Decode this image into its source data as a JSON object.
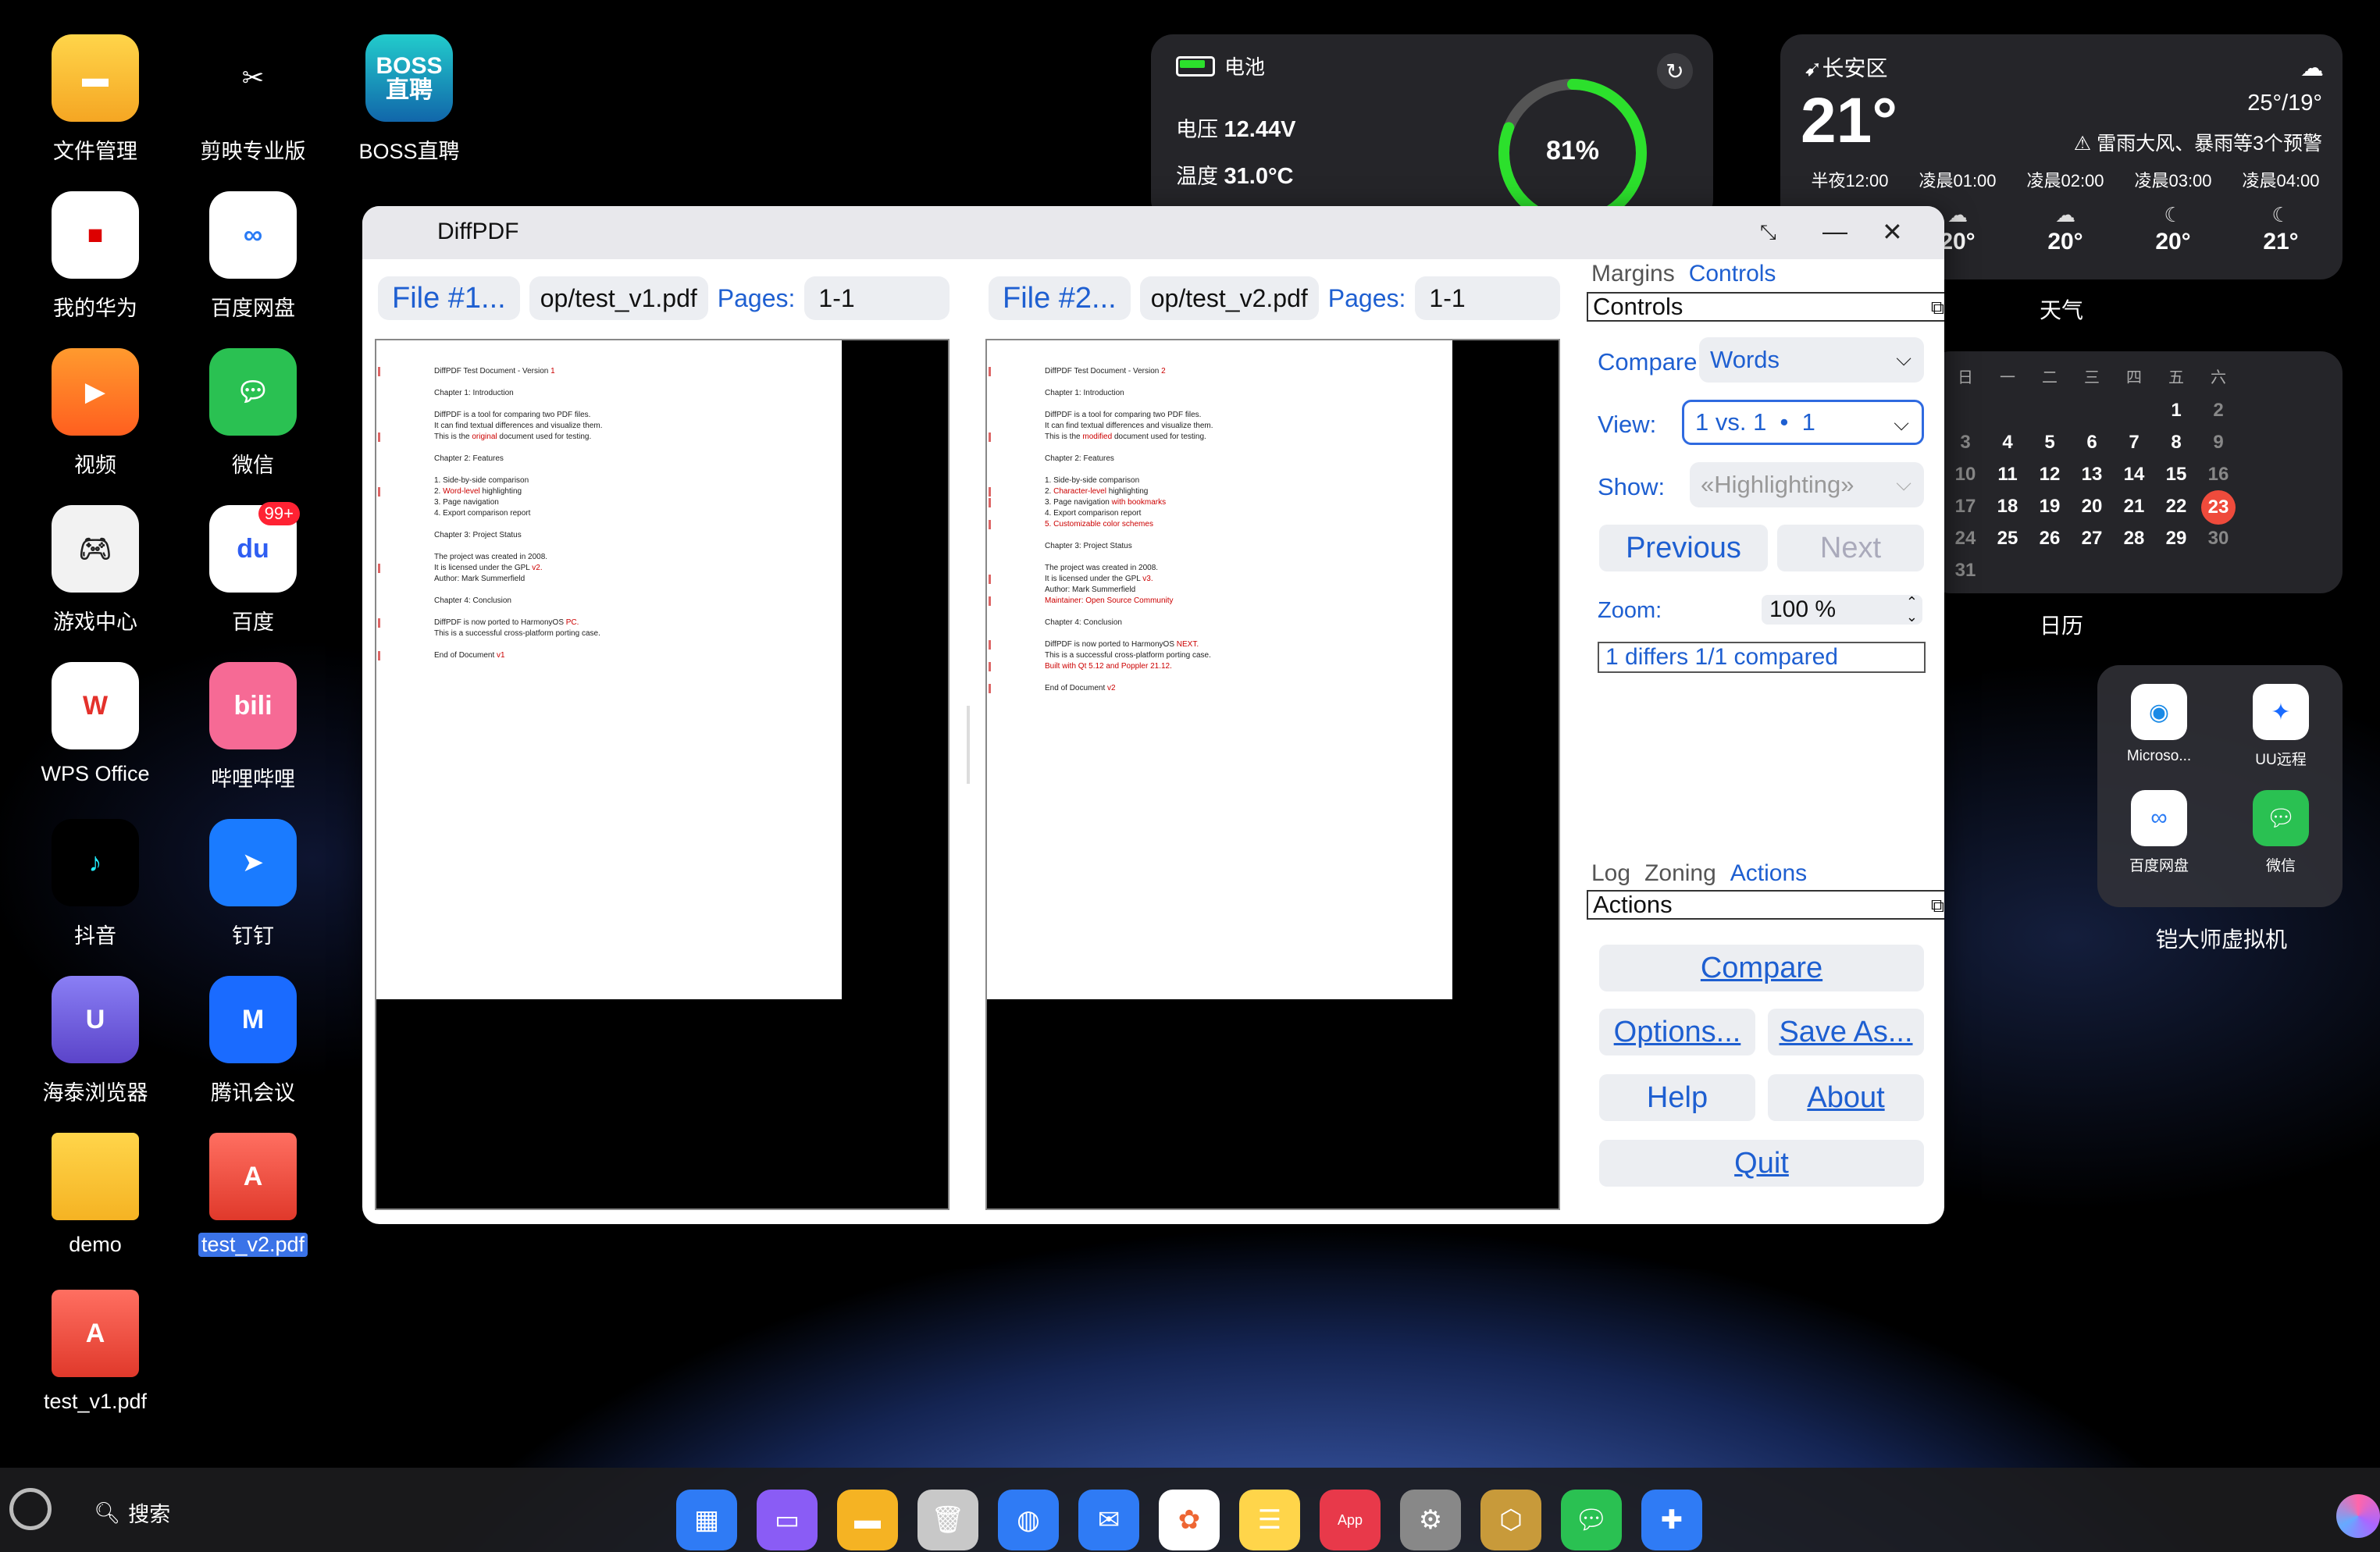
{
  "desktop": {
    "col1": [
      {
        "label": "文件管理",
        "icon": "folder-app-icon"
      },
      {
        "label": "我的华为",
        "icon": "huawei-icon"
      },
      {
        "label": "视频",
        "icon": "video-icon"
      },
      {
        "label": "游戏中心",
        "icon": "gamepad-icon"
      },
      {
        "label": "WPS Office",
        "icon": "wps-icon"
      },
      {
        "label": "抖音",
        "icon": "douyin-icon"
      },
      {
        "label": "海泰浏览器",
        "icon": "browser-icon"
      },
      {
        "label": "demo",
        "icon": "folder-icon"
      },
      {
        "label": "test_v1.pdf",
        "icon": "pdf-file-icon"
      }
    ],
    "col2": [
      {
        "label": "剪映专业版",
        "icon": "capcut-icon"
      },
      {
        "label": "百度网盘",
        "icon": "baidu-netdisk-icon"
      },
      {
        "label": "微信",
        "icon": "wechat-icon"
      },
      {
        "label": "百度",
        "icon": "baidu-icon",
        "badge": "99+"
      },
      {
        "label": "哔哩哔哩",
        "icon": "bilibili-icon"
      },
      {
        "label": "钉钉",
        "icon": "dingtalk-icon"
      },
      {
        "label": "腾讯会议",
        "icon": "tencent-meeting-icon"
      },
      {
        "label": "test_v2.pdf",
        "icon": "pdf-file-icon"
      }
    ],
    "col3": [
      {
        "label": "BOSS直聘",
        "icon": "boss-icon",
        "text": "BOSS\n直聘"
      }
    ]
  },
  "battery": {
    "title": "电池",
    "voltage_label": "电压",
    "voltage": "12.44V",
    "temp_label": "温度",
    "temp": "31.0°C",
    "percent_text": "81%",
    "percent": 0.81,
    "ring_color": "#2ce02c"
  },
  "weather": {
    "location": "长安区",
    "temp": "21°",
    "range": "25°/19°",
    "warning": "雷雨大风、暴雨等3个预警",
    "hours": [
      {
        "time": "半夜12:00",
        "temp": ""
      },
      {
        "time": "凌晨01:00",
        "temp": "20°"
      },
      {
        "time": "凌晨02:00",
        "temp": "20°"
      },
      {
        "time": "凌晨03:00",
        "temp": "20°"
      },
      {
        "time": "凌晨04:00",
        "temp": "21°"
      }
    ],
    "widget_label": "天气"
  },
  "calendar": {
    "headers": [
      "日",
      "一",
      "二",
      "三",
      "四",
      "五",
      "六"
    ],
    "rows": [
      [
        "",
        "",
        "",
        "",
        "",
        "1",
        "2"
      ],
      [
        "3",
        "4",
        "5",
        "6",
        "7",
        "8",
        "9"
      ],
      [
        "10",
        "11",
        "12",
        "13",
        "14",
        "15",
        "16"
      ],
      [
        "17",
        "18",
        "19",
        "20",
        "21",
        "22",
        "23"
      ],
      [
        "24",
        "25",
        "26",
        "27",
        "28",
        "29",
        "30"
      ],
      [
        "31",
        "",
        "",
        "",
        "",
        "",
        ""
      ]
    ],
    "today": "23",
    "widget_label": "日历"
  },
  "vm_folder": {
    "apps": [
      {
        "label": "Microso...",
        "icon": "edge-icon"
      },
      {
        "label": "UU远程",
        "icon": "uu-remote-icon"
      },
      {
        "label": "百度网盘",
        "icon": "baidu-netdisk-icon"
      },
      {
        "label": "微信",
        "icon": "wechat-icon"
      }
    ],
    "label": "铠大师虚拟机"
  },
  "dock": {
    "search_label": "搜索",
    "apps": [
      "app-grid-icon",
      "multitask-icon",
      "files-icon",
      "trash-icon",
      "browser-icon",
      "mail-icon",
      "photos-icon",
      "notes-icon",
      "app-gallery-icon",
      "settings-icon",
      "security-icon",
      "wechat-icon",
      "plugin-icon"
    ]
  },
  "diffpdf": {
    "title": "DiffPDF",
    "file1": {
      "button": "File #1...",
      "path": "op/test_v1.pdf",
      "pages_label": "Pages:",
      "pages": "1-1"
    },
    "file2": {
      "button": "File #2...",
      "path": "op/test_v2.pdf",
      "pages_label": "Pages:",
      "pages": "1-1"
    },
    "doc1": [
      {
        "parts": [
          [
            "DiffPDF Test Document - Version ",
            0
          ],
          [
            "1",
            1
          ]
        ]
      },
      {
        "parts": [
          [
            "Chapter 1: Introduction",
            0
          ]
        ],
        "gap": 1
      },
      {
        "parts": [
          [
            "DiffPDF is a tool for comparing two PDF files.",
            0
          ]
        ],
        "gap": 1
      },
      {
        "parts": [
          [
            "It can find textual differences and visualize them.",
            0
          ]
        ]
      },
      {
        "parts": [
          [
            "This is the ",
            0
          ],
          [
            "original",
            1
          ],
          [
            " document used for testing.",
            0
          ]
        ]
      },
      {
        "parts": [
          [
            "Chapter 2: Features",
            0
          ]
        ],
        "gap": 1
      },
      {
        "parts": [
          [
            "1. Side-by-side comparison",
            0
          ]
        ],
        "gap": 1
      },
      {
        "parts": [
          [
            "2. ",
            0
          ],
          [
            "Word-level",
            1
          ],
          [
            " highlighting",
            0
          ]
        ]
      },
      {
        "parts": [
          [
            "3. Page navigation",
            0
          ]
        ]
      },
      {
        "parts": [
          [
            "4. Export comparison report",
            0
          ]
        ]
      },
      {
        "parts": [
          [
            "Chapter 3: Project Status",
            0
          ]
        ],
        "gap": 1
      },
      {
        "parts": [
          [
            "The project was created in 2008.",
            0
          ]
        ],
        "gap": 1
      },
      {
        "parts": [
          [
            "It is licensed under the GPL ",
            0
          ],
          [
            "v2.",
            1
          ]
        ]
      },
      {
        "parts": [
          [
            "Author: Mark Summerfield",
            0
          ]
        ]
      },
      {
        "parts": [
          [
            "Chapter 4: Conclusion",
            0
          ]
        ],
        "gap": 1
      },
      {
        "parts": [
          [
            "DiffPDF is now ported to HarmonyOS ",
            0
          ],
          [
            "PC.",
            1
          ]
        ],
        "gap": 1
      },
      {
        "parts": [
          [
            "This is a successful cross-platform porting case.",
            0
          ]
        ]
      },
      {
        "parts": [
          [
            "End of Document ",
            0
          ],
          [
            "v1",
            1
          ]
        ],
        "gap": 1
      }
    ],
    "doc2": [
      {
        "parts": [
          [
            "DiffPDF Test Document - Version ",
            0
          ],
          [
            "2",
            1
          ]
        ]
      },
      {
        "parts": [
          [
            "Chapter 1: Introduction",
            0
          ]
        ],
        "gap": 1
      },
      {
        "parts": [
          [
            "DiffPDF is a tool for comparing two PDF files.",
            0
          ]
        ],
        "gap": 1
      },
      {
        "parts": [
          [
            "It can find textual differences and visualize them.",
            0
          ]
        ]
      },
      {
        "parts": [
          [
            "This is the ",
            0
          ],
          [
            "modified",
            1
          ],
          [
            " document used for testing.",
            0
          ]
        ]
      },
      {
        "parts": [
          [
            "Chapter 2: Features",
            0
          ]
        ],
        "gap": 1
      },
      {
        "parts": [
          [
            "1. Side-by-side comparison",
            0
          ]
        ],
        "gap": 1
      },
      {
        "parts": [
          [
            "2. ",
            0
          ],
          [
            "Character-level",
            1
          ],
          [
            " highlighting",
            0
          ]
        ]
      },
      {
        "parts": [
          [
            "3. Page navigation ",
            0
          ],
          [
            "with bookmarks",
            1
          ]
        ]
      },
      {
        "parts": [
          [
            "4. Export comparison report",
            0
          ]
        ]
      },
      {
        "parts": [
          [
            "5. Customizable color schemes",
            1
          ]
        ]
      },
      {
        "parts": [
          [
            "Chapter 3: Project Status",
            0
          ]
        ],
        "gap": 1
      },
      {
        "parts": [
          [
            "The project was created in 2008.",
            0
          ]
        ],
        "gap": 1
      },
      {
        "parts": [
          [
            "It is licensed under the GPL ",
            0
          ],
          [
            "v3.",
            1
          ]
        ]
      },
      {
        "parts": [
          [
            "Author: Mark Summerfield",
            0
          ]
        ]
      },
      {
        "parts": [
          [
            "Maintainer: Open Source Community",
            1
          ]
        ]
      },
      {
        "parts": [
          [
            "Chapter 4: Conclusion",
            0
          ]
        ],
        "gap": 1
      },
      {
        "parts": [
          [
            "DiffPDF is now ported to HarmonyOS ",
            0
          ],
          [
            "NEXT.",
            1
          ]
        ],
        "gap": 1
      },
      {
        "parts": [
          [
            "This is a successful cross-platform porting case.",
            0
          ]
        ]
      },
      {
        "parts": [
          [
            "Built with Qt 5.12 and Poppler 21.12.",
            1
          ]
        ]
      },
      {
        "parts": [
          [
            "End of Document ",
            0
          ],
          [
            "v2",
            1
          ]
        ],
        "gap": 1
      }
    ],
    "top_tabs": [
      "Margins",
      "Controls"
    ],
    "top_tab_active": "Controls",
    "controls_title": "Controls",
    "compare_label": "Compare:",
    "compare_value": "Words",
    "view_label": "View:",
    "view_value": "1 vs. 1  •  1",
    "show_label": "Show:",
    "show_value": "«Highlighting»",
    "previous": "Previous",
    "next": "Next",
    "zoom_label": "Zoom:",
    "zoom_value": "100 %",
    "status": "1 differs 1/1 compared",
    "bottom_tabs": [
      "Log",
      "Zoning",
      "Actions"
    ],
    "bottom_tab_active": "Actions",
    "actions_title": "Actions",
    "buttons": {
      "compare": "Compare",
      "options": "Options...",
      "save_as": "Save As...",
      "help": "Help",
      "about": "About",
      "quit": "Quit"
    }
  }
}
